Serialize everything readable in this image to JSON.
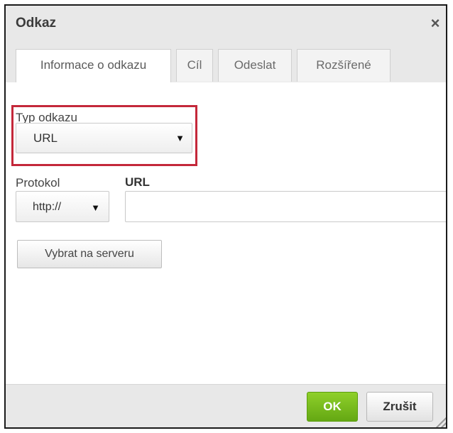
{
  "dialog": {
    "title": "Odkaz",
    "close_icon": "×"
  },
  "tabs": [
    {
      "label": "Informace o odkazu",
      "active": true
    },
    {
      "label": "Cíl",
      "active": false
    },
    {
      "label": "Odeslat",
      "active": false
    },
    {
      "label": "Rozšířené",
      "active": false
    }
  ],
  "form": {
    "link_type_label": "Typ odkazu",
    "link_type_value": "URL",
    "protocol_label": "Protokol",
    "protocol_value": "http://",
    "url_label": "URL",
    "url_value": "",
    "browse_button": "Vybrat na serveru",
    "dropdown_arrow": "▼"
  },
  "footer": {
    "ok_label": "OK",
    "cancel_label": "Zrušit"
  },
  "colors": {
    "highlight_border": "#c4283a",
    "ok_button": "#6cb31a"
  }
}
